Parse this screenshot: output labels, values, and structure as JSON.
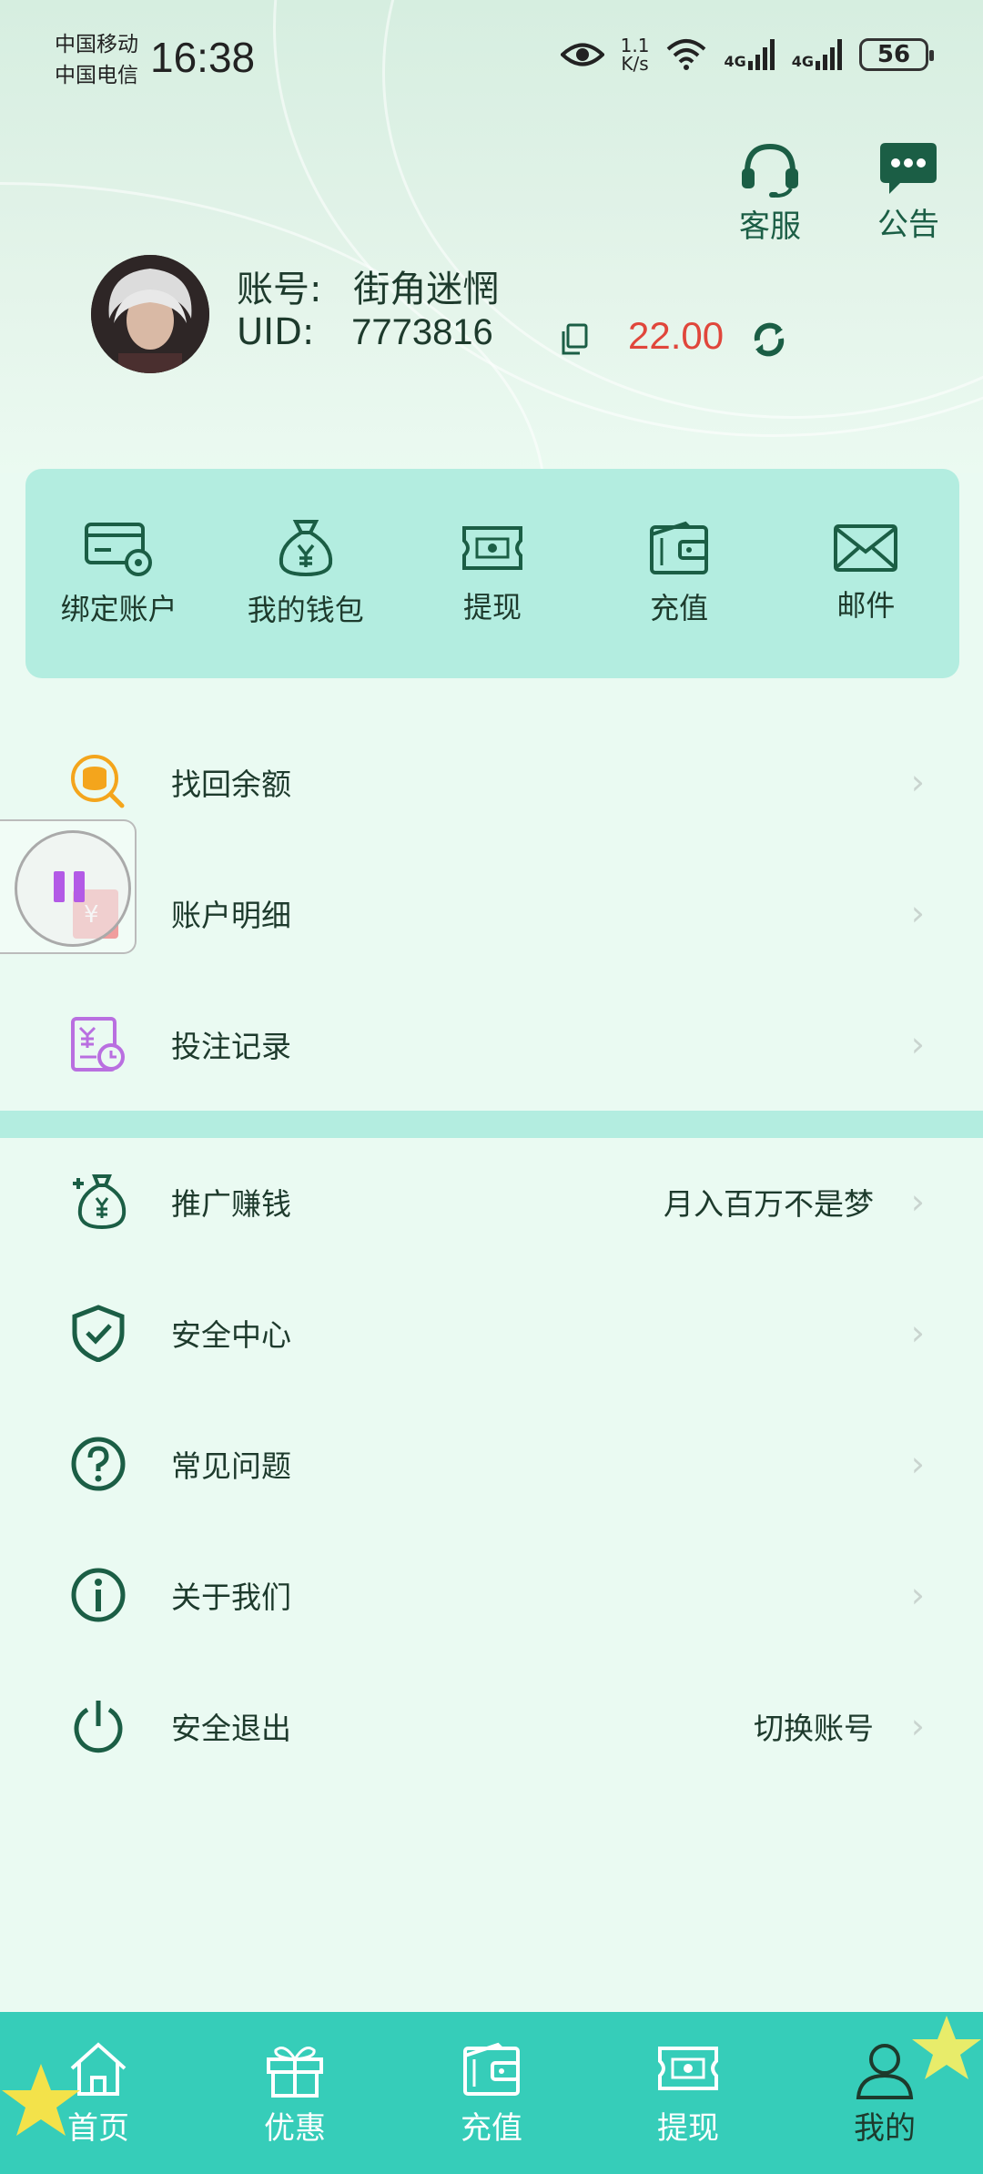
{
  "status_bar": {
    "carrier_1": "中国移动",
    "carrier_2": "中国电信",
    "time": "16:38",
    "net_speed_value": "1.1",
    "net_speed_unit": "K/s",
    "signal_1": "4G",
    "signal_2": "4G",
    "battery": "56"
  },
  "top_actions": {
    "service_label": "客服",
    "notice_label": "公告"
  },
  "profile": {
    "account_label": "账号:",
    "account_name": "街角迷惘",
    "uid_label": "UID:",
    "uid": "7773816",
    "balance": "22.00"
  },
  "quick_actions": [
    {
      "label": "绑定账户",
      "icon": "card-gear-icon"
    },
    {
      "label": "我的钱包",
      "icon": "money-bag-icon"
    },
    {
      "label": "提现",
      "icon": "ticket-icon"
    },
    {
      "label": "充值",
      "icon": "wallet-icon"
    },
    {
      "label": "邮件",
      "icon": "mail-icon"
    }
  ],
  "menu_group_1": [
    {
      "label": "找回余额",
      "icon": "coin-search-icon"
    },
    {
      "label": "账户明细",
      "icon": "ledger-icon"
    },
    {
      "label": "投注记录",
      "icon": "bet-record-icon"
    }
  ],
  "menu_group_2": [
    {
      "label": "推广赚钱",
      "extra": "月入百万不是梦",
      "icon": "promo-bag-icon"
    },
    {
      "label": "安全中心",
      "extra": "",
      "icon": "shield-check-icon"
    },
    {
      "label": "常见问题",
      "extra": "",
      "icon": "question-icon"
    },
    {
      "label": "关于我们",
      "extra": "",
      "icon": "info-icon"
    },
    {
      "label": "安全退出",
      "extra": "切换账号",
      "icon": "power-icon"
    }
  ],
  "bottom_nav": [
    {
      "label": "首页",
      "icon": "home-icon",
      "active": false
    },
    {
      "label": "优惠",
      "icon": "gift-icon",
      "active": false
    },
    {
      "label": "充值",
      "icon": "wallet-icon",
      "active": false
    },
    {
      "label": "提现",
      "icon": "ticket-icon",
      "active": false
    },
    {
      "label": "我的",
      "icon": "user-icon",
      "active": true
    }
  ],
  "colors": {
    "accent": "#36cdb9",
    "panel": "#b3ede0",
    "balance_red": "#e0463b",
    "icon_green": "#1b5e45"
  }
}
